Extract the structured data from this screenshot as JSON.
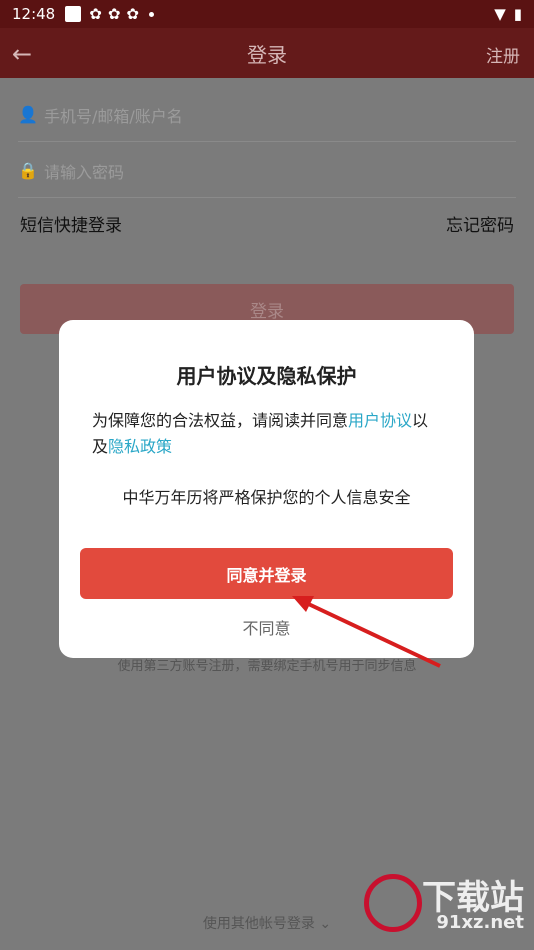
{
  "status": {
    "time": "12:48",
    "icons": [
      "square-icon",
      "pinwheel-icon",
      "pinwheel-icon",
      "pinwheel-icon",
      "dot-icon"
    ],
    "right_icons": [
      "wifi-icon",
      "battery-icon"
    ]
  },
  "appbar": {
    "title": "登录",
    "register": "注册"
  },
  "form": {
    "account_placeholder": "手机号/邮箱/账户名",
    "password_placeholder": "请输入密码",
    "sms_login": "短信快捷登录",
    "forgot": "忘记密码",
    "login_button": "登录"
  },
  "dialog": {
    "title": "用户协议及隐私保护",
    "msg_prefix": "为保障您的合法权益，请阅读并同意",
    "msg_link1": "用户协议",
    "msg_mid": "以及",
    "msg_link2": "隐私政策",
    "notice": "中华万年历将严格保护您的个人信息安全",
    "agree_button": "同意并登录",
    "disagree_button": "不同意"
  },
  "footer": {
    "third_party_note": "使用第三方账号注册，需要绑定手机号用于同步信息",
    "other_login": "使用其他帐号登录 ⌄"
  },
  "watermark": {
    "text1": "下载站",
    "text2": "91xz.net"
  },
  "colors": {
    "accent": "#e24a3d",
    "link": "#2aa7c7",
    "appbar": "#641a1a"
  }
}
